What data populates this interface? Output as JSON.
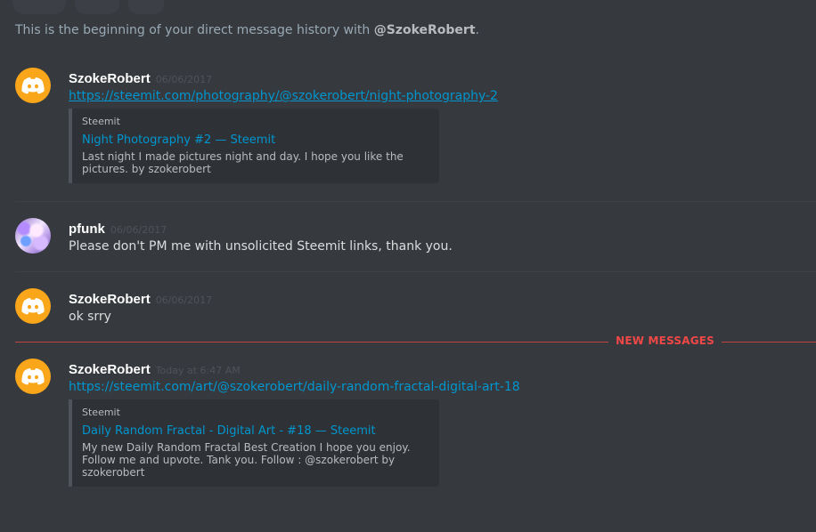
{
  "intro": {
    "prefix": "This is the beginning of your direct message history with ",
    "handle": "@SzokeRobert",
    "suffix": "."
  },
  "messages": [
    {
      "username": "SzokeRobert",
      "timestamp": "06/06/2017",
      "link": "https://steemit.com/photography/@szokerobert/night-photography-2",
      "embed": {
        "provider": "Steemit",
        "title": "Night Photography #2 — Steemit",
        "description": "Last night I made pictures night and day. I hope you like the\npictures. by szokerobert"
      }
    },
    {
      "username": "pfunk",
      "timestamp": "06/06/2017",
      "text": "Please don't PM me with unsolicited Steemit links, thank you."
    },
    {
      "username": "SzokeRobert",
      "timestamp": "06/06/2017",
      "text": "ok srry"
    },
    {
      "username": "SzokeRobert",
      "timestamp": "Today at 6:47 AM",
      "link": "https://steemit.com/art/@szokerobert/daily-random-fractal-digital-art-18",
      "embed": {
        "provider": "Steemit",
        "title": "Daily Random Fractal - Digital Art - #18 — Steemit",
        "description": "My new Daily Random Fractal Best Creation I hope you enjoy.\nFollow me and upvote. Tank you. Follow : @szokerobert by\nszokerobert"
      }
    }
  ],
  "new_messages_label": "NEW MESSAGES",
  "icons": {
    "discord_avatar": "discord-logo-icon",
    "pfunk_avatar": "avatar-image"
  },
  "colors": {
    "background": "#36393e",
    "avatar_orange": "#faa61a",
    "link": "#0096cf",
    "new_messages": "#f04747"
  }
}
